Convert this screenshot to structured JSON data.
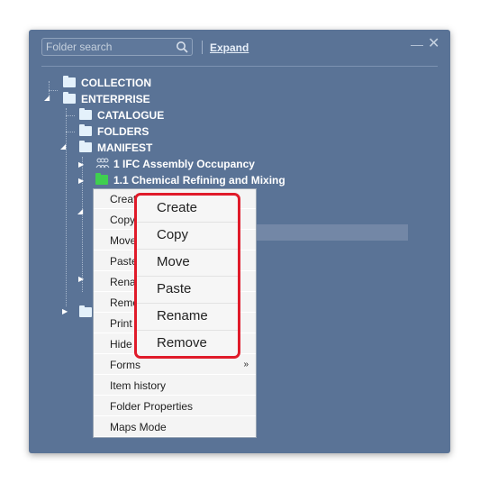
{
  "search": {
    "placeholder": "Folder search",
    "expand_label": "Expand"
  },
  "window": {
    "minimize": "—",
    "close": "✕"
  },
  "tree": {
    "collection": "COLLECTION",
    "enterprise": "ENTERPRISE",
    "catalogue": "CATALOGUE",
    "folders": "FOLDERS",
    "manifest": "MANIFEST",
    "ifc": "1 IFC Assembly Occupancy",
    "chemical": "1.1 Chemical Refining and Mixing"
  },
  "context_menu": {
    "items": [
      "Create",
      "Copy",
      "Move",
      "Paste",
      "Rename",
      "Remove",
      "Print",
      "Hide",
      "Forms",
      "Item history",
      "Folder Properties",
      "Maps Mode"
    ],
    "submenu_arrow": "»"
  },
  "callout_menu": {
    "items": [
      "Create",
      "Copy",
      "Move",
      "Paste",
      "Rename",
      "Remove"
    ]
  },
  "colors": {
    "panel": "#5a7396",
    "callout_border": "#e01b2a",
    "green_folder": "#3fcf4f"
  }
}
